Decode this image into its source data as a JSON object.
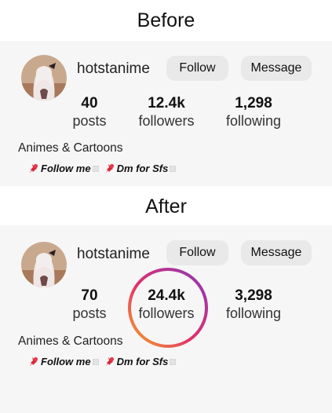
{
  "before": {
    "heading": "Before",
    "profile": {
      "username": "hotstanime",
      "follow_label": "Follow",
      "message_label": "Message",
      "posts_count": "40",
      "posts_label": "posts",
      "followers_count": "12.4k",
      "followers_label": "followers",
      "following_count": "1,298",
      "following_label": "following",
      "bio": "Animes & Cartoons",
      "tag1": "Follow me",
      "tag2": "Dm for Sfs"
    }
  },
  "after": {
    "heading": "After",
    "profile": {
      "username": "hotstanime",
      "follow_label": "Follow",
      "message_label": "Message",
      "posts_count": "70",
      "posts_label": "posts",
      "followers_count": "24.4k",
      "followers_label": "followers",
      "following_count": "3,298",
      "following_label": "following",
      "bio": "Animes & Cartoons",
      "tag1": "Follow me",
      "tag2": "Dm for Sfs"
    }
  },
  "colors": {
    "ring_start": "#f5a623",
    "ring_mid": "#e1306c",
    "ring_end": "#8a3ab9"
  },
  "icons": {
    "tag": "pushpin-icon"
  }
}
